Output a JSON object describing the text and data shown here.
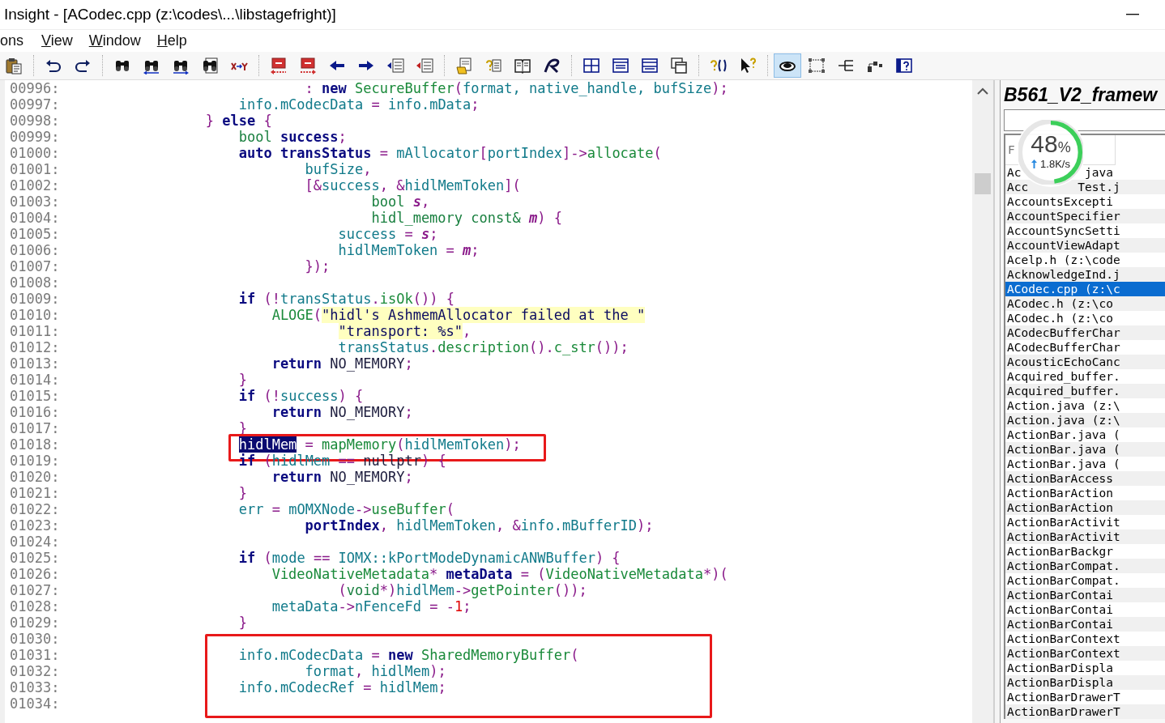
{
  "window": {
    "title": "Insight - [ACodec.cpp (z:\\codes\\...\\libstagefright)]"
  },
  "menu": [
    {
      "label": "ons",
      "mnemonic": false
    },
    {
      "label": "View",
      "mnemonic": true
    },
    {
      "label": "Window",
      "mnemonic": true
    },
    {
      "label": "Help",
      "mnemonic": true
    }
  ],
  "toolbar": [
    [
      {
        "selected": false
      }
    ],
    [
      {
        "selected": false
      },
      {
        "selected": false
      }
    ],
    [
      {
        "selected": false
      },
      {
        "selected": false
      },
      {
        "selected": false
      },
      {
        "selected": false
      },
      {
        "selected": false
      }
    ],
    [
      {
        "selected": false
      },
      {
        "selected": false
      },
      {
        "selected": false
      },
      {
        "selected": false
      },
      {
        "selected": false
      },
      {
        "selected": false
      }
    ],
    [
      {
        "selected": false
      },
      {
        "selected": false
      },
      {
        "selected": false
      },
      {
        "selected": false
      }
    ],
    [
      {
        "selected": false
      },
      {
        "selected": false
      },
      {
        "selected": false
      },
      {
        "selected": false
      }
    ],
    [
      {
        "selected": false
      },
      {
        "selected": false
      }
    ],
    [
      {
        "selected": true
      },
      {
        "selected": false
      },
      {
        "selected": false
      },
      {
        "selected": false
      },
      {
        "selected": false
      }
    ]
  ],
  "editor": {
    "blocks": [
      {
        "lines": [
          {
            "number": "00996:",
            "tokens": [
              {
                "kind": "op",
                "text": "                            : "
              },
              {
                "kind": "kw",
                "text": "new "
              },
              {
                "kind": "fn",
                "text": "SecureBuffer"
              },
              {
                "kind": "op",
                "text": "("
              },
              {
                "kind": "id",
                "text": "format, native_handle, bufSize"
              },
              {
                "kind": "op",
                "text": ");"
              }
            ]
          },
          {
            "number": "00997:",
            "tokens": [
              {
                "kind": "id",
                "text": "                    info.mCodecData"
              },
              {
                "kind": "op",
                "text": " = "
              },
              {
                "kind": "id",
                "text": "info.mData"
              },
              {
                "kind": "op",
                "text": ";"
              }
            ]
          },
          {
            "number": "00998:",
            "tokens": [
              {
                "kind": "op",
                "text": "                } "
              },
              {
                "kind": "kw",
                "text": "else"
              },
              {
                "kind": "op",
                "text": " {"
              }
            ]
          },
          {
            "number": "00999:",
            "tokens": [
              {
                "kind": "type",
                "text": "                    bool "
              },
              {
                "kind": "decl",
                "text": "success"
              },
              {
                "kind": "op",
                "text": ";"
              }
            ]
          },
          {
            "number": "01000:",
            "tokens": [
              {
                "kind": "kw",
                "text": "                    auto "
              },
              {
                "kind": "decl",
                "text": "transStatus"
              },
              {
                "kind": "op",
                "text": " = "
              },
              {
                "kind": "id",
                "text": "mAllocator"
              },
              {
                "kind": "op",
                "text": "["
              },
              {
                "kind": "id",
                "text": "portIndex"
              },
              {
                "kind": "op",
                "text": "]->"
              },
              {
                "kind": "fn",
                "text": "allocate"
              },
              {
                "kind": "op",
                "text": "("
              }
            ]
          },
          {
            "number": "01001:",
            "tokens": [
              {
                "kind": "id",
                "text": "                            bufSize"
              },
              {
                "kind": "op",
                "text": ","
              }
            ]
          },
          {
            "number": "01002:",
            "tokens": [
              {
                "kind": "op",
                "text": "                            [&"
              },
              {
                "kind": "id",
                "text": "success"
              },
              {
                "kind": "op",
                "text": ", &"
              },
              {
                "kind": "id",
                "text": "hidlMemToken"
              },
              {
                "kind": "op",
                "text": "]("
              }
            ]
          },
          {
            "number": "01003:",
            "tokens": [
              {
                "kind": "type",
                "text": "                                    bool "
              },
              {
                "kind": "param",
                "text": "s"
              },
              {
                "kind": "op",
                "text": ","
              }
            ]
          },
          {
            "number": "01004:",
            "tokens": [
              {
                "kind": "type",
                "text": "                                    hidl_memory const& "
              },
              {
                "kind": "param",
                "text": "m"
              },
              {
                "kind": "op",
                "text": ") {"
              }
            ]
          },
          {
            "number": "01005:",
            "tokens": [
              {
                "kind": "id",
                "text": "                                success"
              },
              {
                "kind": "op",
                "text": " = "
              },
              {
                "kind": "param",
                "text": "s"
              },
              {
                "kind": "op",
                "text": ";"
              }
            ]
          },
          {
            "number": "01006:",
            "tokens": [
              {
                "kind": "id",
                "text": "                                hidlMemToken"
              },
              {
                "kind": "op",
                "text": " = "
              },
              {
                "kind": "param",
                "text": "m"
              },
              {
                "kind": "op",
                "text": ";"
              }
            ]
          },
          {
            "number": "01007:",
            "tokens": [
              {
                "kind": "op",
                "text": "                            });"
              }
            ]
          },
          {
            "number": "01008:"
          },
          {
            "number": "01009:",
            "tokens": [
              {
                "kind": "kw",
                "text": "                    if"
              },
              {
                "kind": "op",
                "text": " (!"
              },
              {
                "kind": "id",
                "text": "transStatus"
              },
              {
                "kind": "op",
                "text": "."
              },
              {
                "kind": "fn",
                "text": "isOk"
              },
              {
                "kind": "op",
                "text": "()) {"
              }
            ]
          },
          {
            "number": "01010:",
            "tokens": [
              {
                "kind": "fn",
                "text": "                        ALOGE"
              },
              {
                "kind": "op",
                "text": "("
              },
              {
                "kind": "str",
                "text": "\"hidl's AshmemAllocator failed at the \""
              }
            ]
          },
          {
            "number": "01011:",
            "tokens": [
              {
                "kind": "str",
                "text": "                                \"transport: %s\""
              },
              {
                "kind": "op",
                "text": ","
              }
            ]
          },
          {
            "number": "01012:",
            "tokens": [
              {
                "kind": "id",
                "text": "                                transStatus"
              },
              {
                "kind": "op",
                "text": "."
              },
              {
                "kind": "fn",
                "text": "description"
              },
              {
                "kind": "op",
                "text": "()."
              },
              {
                "kind": "fn",
                "text": "c_str"
              },
              {
                "kind": "op",
                "text": "());"
              }
            ]
          },
          {
            "number": "01013:",
            "tokens": [
              {
                "kind": "kw",
                "text": "                        return "
              },
              {
                "kind": "const",
                "text": "NO_MEMORY"
              },
              {
                "kind": "op",
                "text": ";"
              }
            ]
          },
          {
            "number": "01014:",
            "tokens": [
              {
                "kind": "op",
                "text": "                    }"
              }
            ]
          },
          {
            "number": "01015:",
            "tokens": [
              {
                "kind": "kw",
                "text": "                    if"
              },
              {
                "kind": "op",
                "text": " (!"
              },
              {
                "kind": "id",
                "text": "success"
              },
              {
                "kind": "op",
                "text": ") {"
              }
            ]
          },
          {
            "number": "01016:",
            "tokens": [
              {
                "kind": "kw",
                "text": "                        return "
              },
              {
                "kind": "const",
                "text": "NO_MEMORY"
              },
              {
                "kind": "op",
                "text": ";"
              }
            ]
          },
          {
            "number": "01017:",
            "tokens": [
              {
                "kind": "op",
                "text": "                    }"
              }
            ]
          }
        ]
      },
      {
        "framed": true,
        "lines": [
          {
            "number": "01018:",
            "tokens": [
              {
                "kind": "selection",
                "text": "                    hidlMem"
              },
              {
                "kind": "op",
                "text": " = "
              },
              {
                "kind": "fn",
                "text": "mapMemory"
              },
              {
                "kind": "op",
                "text": "("
              },
              {
                "kind": "id",
                "text": "hidlMemToken"
              },
              {
                "kind": "op",
                "text": ");"
              }
            ]
          }
        ]
      },
      {
        "lines": [
          {
            "number": "01019:",
            "tokens": [
              {
                "kind": "kw",
                "text": "                    if"
              },
              {
                "kind": "op",
                "text": " ("
              },
              {
                "kind": "id",
                "text": "hidlMem"
              },
              {
                "kind": "op",
                "text": " == "
              },
              {
                "kind": "const",
                "text": "nullptr"
              },
              {
                "kind": "op",
                "text": ") {"
              }
            ]
          },
          {
            "number": "01020:",
            "tokens": [
              {
                "kind": "kw",
                "text": "                        return "
              },
              {
                "kind": "const",
                "text": "NO_MEMORY"
              },
              {
                "kind": "op",
                "text": ";"
              }
            ]
          },
          {
            "number": "01021:",
            "tokens": [
              {
                "kind": "op",
                "text": "                    }"
              }
            ]
          },
          {
            "number": "01022:",
            "tokens": [
              {
                "kind": "id",
                "text": "                    err"
              },
              {
                "kind": "op",
                "text": " = "
              },
              {
                "kind": "id",
                "text": "mOMXNode"
              },
              {
                "kind": "op",
                "text": "->"
              },
              {
                "kind": "fn",
                "text": "useBuffer"
              },
              {
                "kind": "op",
                "text": "("
              }
            ]
          },
          {
            "number": "01023:",
            "tokens": [
              {
                "kind": "decl",
                "text": "                            portIndex"
              },
              {
                "kind": "op",
                "text": ", "
              },
              {
                "kind": "id",
                "text": "hidlMemToken"
              },
              {
                "kind": "op",
                "text": ", &"
              },
              {
                "kind": "id",
                "text": "info.mBufferID"
              },
              {
                "kind": "op",
                "text": ");"
              }
            ]
          },
          {
            "number": "01024:"
          },
          {
            "number": "01025:",
            "tokens": [
              {
                "kind": "kw",
                "text": "                    if"
              },
              {
                "kind": "op",
                "text": " ("
              },
              {
                "kind": "id",
                "text": "mode"
              },
              {
                "kind": "op",
                "text": " == "
              },
              {
                "kind": "id",
                "text": "IOMX::kPortModeDynamicANWBuffer"
              },
              {
                "kind": "op",
                "text": ") {"
              }
            ]
          },
          {
            "number": "01026:",
            "tokens": [
              {
                "kind": "fn",
                "text": "                        VideoNativeMetadata"
              },
              {
                "kind": "op",
                "text": "* "
              },
              {
                "kind": "decl",
                "text": "metaData"
              },
              {
                "kind": "op",
                "text": " = ("
              },
              {
                "kind": "fn",
                "text": "VideoNativeMetadata"
              },
              {
                "kind": "op",
                "text": "*)("
              }
            ]
          },
          {
            "number": "01027:",
            "tokens": [
              {
                "kind": "op",
                "text": "                                ("
              },
              {
                "kind": "type",
                "text": "void"
              },
              {
                "kind": "op",
                "text": "*)"
              },
              {
                "kind": "id",
                "text": "hidlMem"
              },
              {
                "kind": "op",
                "text": "->"
              },
              {
                "kind": "fn",
                "text": "getPointer"
              },
              {
                "kind": "op",
                "text": "());"
              }
            ]
          },
          {
            "number": "01028:",
            "tokens": [
              {
                "kind": "id",
                "text": "                        metaData"
              },
              {
                "kind": "op",
                "text": "->"
              },
              {
                "kind": "id",
                "text": "nFenceFd"
              },
              {
                "kind": "op",
                "text": " = -"
              },
              {
                "kind": "num",
                "text": "1"
              },
              {
                "kind": "op",
                "text": ";"
              }
            ]
          },
          {
            "number": "01029:",
            "tokens": [
              {
                "kind": "op",
                "text": "                    }"
              }
            ]
          }
        ]
      },
      {
        "framed": true,
        "lines": [
          {
            "number": "01030:"
          },
          {
            "number": "01031:",
            "tokens": [
              {
                "kind": "id",
                "text": "                    info.mCodecData"
              },
              {
                "kind": "op",
                "text": " = "
              },
              {
                "kind": "kw",
                "text": "new "
              },
              {
                "kind": "fn",
                "text": "SharedMemoryBuffer"
              },
              {
                "kind": "op",
                "text": "("
              }
            ]
          },
          {
            "number": "01032:",
            "tokens": [
              {
                "kind": "id",
                "text": "                            format"
              },
              {
                "kind": "op",
                "text": ", "
              },
              {
                "kind": "id",
                "text": "hidlMem"
              },
              {
                "kind": "op",
                "text": ");"
              }
            ]
          },
          {
            "number": "01033:",
            "tokens": [
              {
                "kind": "id",
                "text": "                    info.mCodecRef"
              },
              {
                "kind": "op",
                "text": " = "
              },
              {
                "kind": "id",
                "text": "hidlMem"
              },
              {
                "kind": "op",
                "text": ";"
              }
            ]
          },
          {
            "number": "01034:"
          }
        ]
      }
    ]
  },
  "project_panel": {
    "title": "B561_V2_framew",
    "header": "F",
    "files": [
      {
        "name_parts": [
          "Ac",
          "java"
        ],
        "selected": false
      },
      {
        "name_parts": [
          "Acc",
          "Test.j"
        ],
        "selected": false
      },
      {
        "name": "AccountsExcepti",
        "selected": false
      },
      {
        "name": "AccountSpecifier",
        "selected": false
      },
      {
        "name": "AccountSyncSetti",
        "selected": false
      },
      {
        "name": "AccountViewAdapt",
        "selected": false
      },
      {
        "name": "Acelp.h (z:\\code",
        "selected": false
      },
      {
        "name": "AcknowledgeInd.j",
        "selected": false
      },
      {
        "name": "ACodec.cpp (z:\\c",
        "selected": true
      },
      {
        "name": "ACodec.h (z:\\co",
        "selected": false
      },
      {
        "name": "ACodec.h (z:\\co",
        "selected": false
      },
      {
        "name": "ACodecBufferChar",
        "selected": false
      },
      {
        "name": "ACodecBufferChar",
        "selected": false
      },
      {
        "name": "AcousticEchoCanc",
        "selected": false
      },
      {
        "name": "Acquired_buffer.",
        "selected": false
      },
      {
        "name": "Acquired_buffer.",
        "selected": false
      },
      {
        "name": "Action.java (z:\\",
        "selected": false
      },
      {
        "name": "Action.java (z:\\",
        "selected": false
      },
      {
        "name": "ActionBar.java (",
        "selected": false
      },
      {
        "name": "ActionBar.java (",
        "selected": false
      },
      {
        "name": "ActionBar.java (",
        "selected": false
      },
      {
        "name": "ActionBarAccess",
        "selected": false
      },
      {
        "name": "ActionBarAction",
        "selected": false
      },
      {
        "name": "ActionBarAction",
        "selected": false
      },
      {
        "name": "ActionBarActivit",
        "selected": false
      },
      {
        "name": "ActionBarActivit",
        "selected": false
      },
      {
        "name": "ActionBarBackgr",
        "selected": false
      },
      {
        "name": "ActionBarCompat.",
        "selected": false
      },
      {
        "name": "ActionBarCompat.",
        "selected": false
      },
      {
        "name": "ActionBarContai",
        "selected": false
      },
      {
        "name": "ActionBarContai",
        "selected": false
      },
      {
        "name": "ActionBarContai",
        "selected": false
      },
      {
        "name": "ActionBarContext",
        "selected": false
      },
      {
        "name": "ActionBarContext",
        "selected": false
      },
      {
        "name": "ActionBarDispla",
        "selected": false
      },
      {
        "name": "ActionBarDispla",
        "selected": false
      },
      {
        "name": "ActionBarDrawerT",
        "selected": false
      },
      {
        "name": "ActionBarDrawerT",
        "selected": false
      }
    ]
  },
  "speed_widget": {
    "value": "48",
    "unit": "%",
    "rate": "1.8K/s",
    "level": 0.48
  }
}
